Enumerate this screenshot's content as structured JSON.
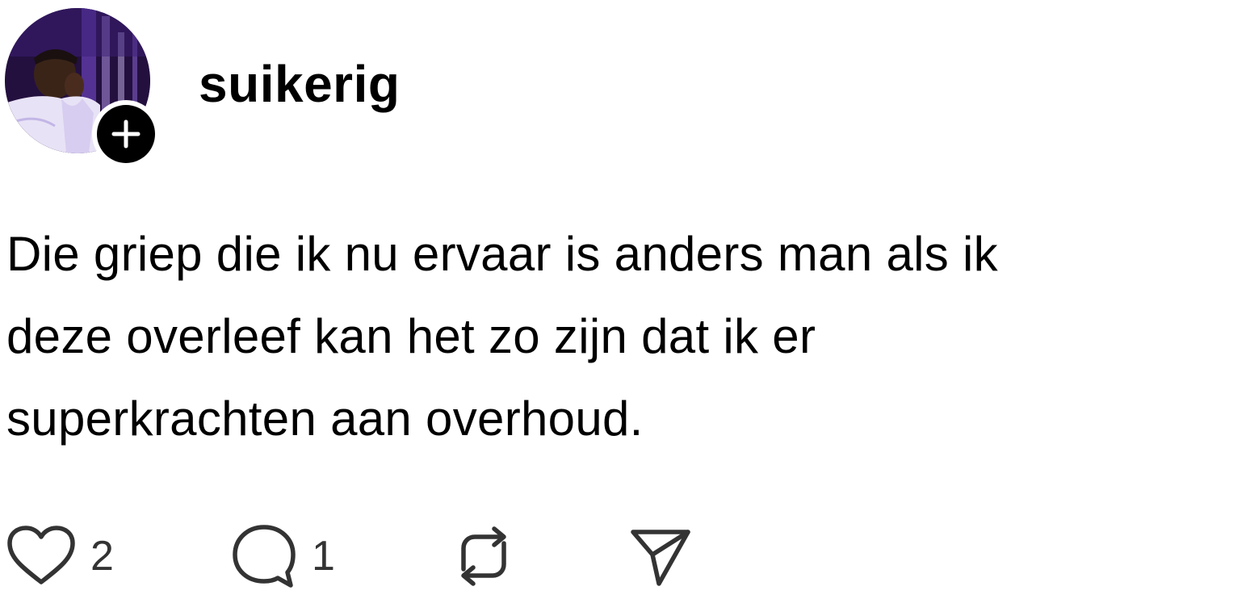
{
  "post": {
    "author": {
      "username": "suikerig",
      "avatar_icon": "profile-photo",
      "follow_icon": "plus-icon"
    },
    "text_lines": [
      "Die griep die ik nu ervaar is anders man als ik",
      "deze overleef kan het zo zijn dat ik er",
      "superkrachten aan overhoud."
    ],
    "actions": {
      "like": {
        "icon": "heart-icon",
        "count": "2"
      },
      "reply": {
        "icon": "comment-icon",
        "count": "1"
      },
      "repost": {
        "icon": "repost-icon"
      },
      "share": {
        "icon": "send-icon"
      }
    }
  },
  "colors": {
    "background": "#ffffff",
    "text": "#000000",
    "count_text": "#333333",
    "icon_stroke": "#333333"
  }
}
